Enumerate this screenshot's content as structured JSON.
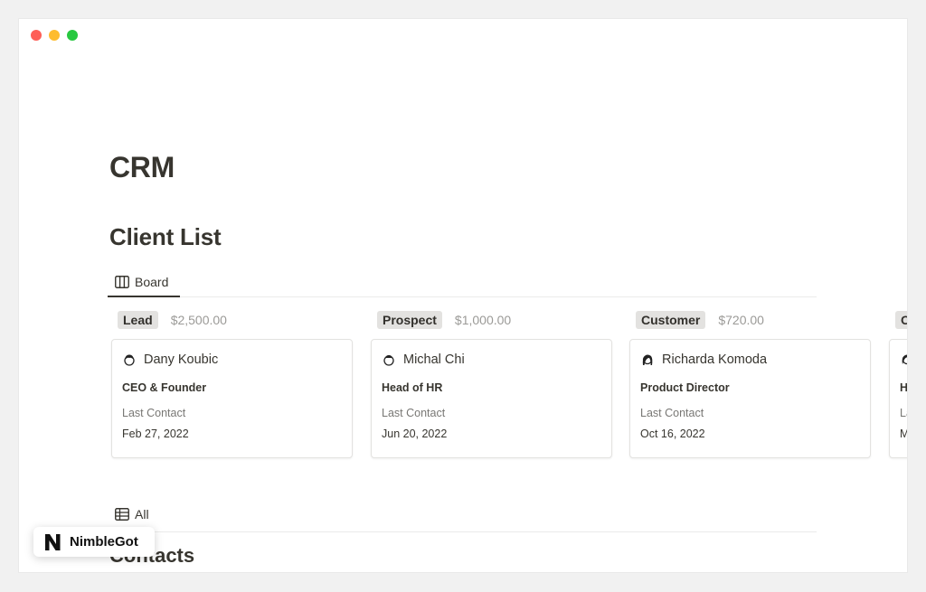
{
  "page": {
    "title": "CRM"
  },
  "client_list": {
    "title": "Client List",
    "view_tab": "Board"
  },
  "columns": [
    {
      "status": "Lead",
      "amount": "$2,500.00",
      "card": {
        "name": "Dany Koubic",
        "role": "CEO & Founder",
        "contact_label": "Last Contact",
        "contact_date": "Feb 27, 2022"
      }
    },
    {
      "status": "Prospect",
      "amount": "$1,000.00",
      "card": {
        "name": "Michal Chi",
        "role": "Head of HR",
        "contact_label": "Last Contact",
        "contact_date": "Jun 20, 2022"
      }
    },
    {
      "status": "Customer",
      "amount": "$720.00",
      "card": {
        "name": "Richarda Komoda",
        "role": "Product Director",
        "contact_label": "Last Contact",
        "contact_date": "Oct 16, 2022"
      }
    },
    {
      "status": "O",
      "amount": "",
      "card": {
        "name": "",
        "role": "H",
        "contact_label": "La",
        "contact_date": "M"
      }
    }
  ],
  "contacts": {
    "view_tab": "All",
    "title": "Contacts"
  },
  "badge": {
    "text": "NimbleGot"
  },
  "colors": {
    "accent": "#37352f",
    "pill_bg": "#e3e2e0",
    "muted": "#9b9a97"
  },
  "icons": {
    "board_tab": "board-icon",
    "table_tab": "table-icon"
  }
}
